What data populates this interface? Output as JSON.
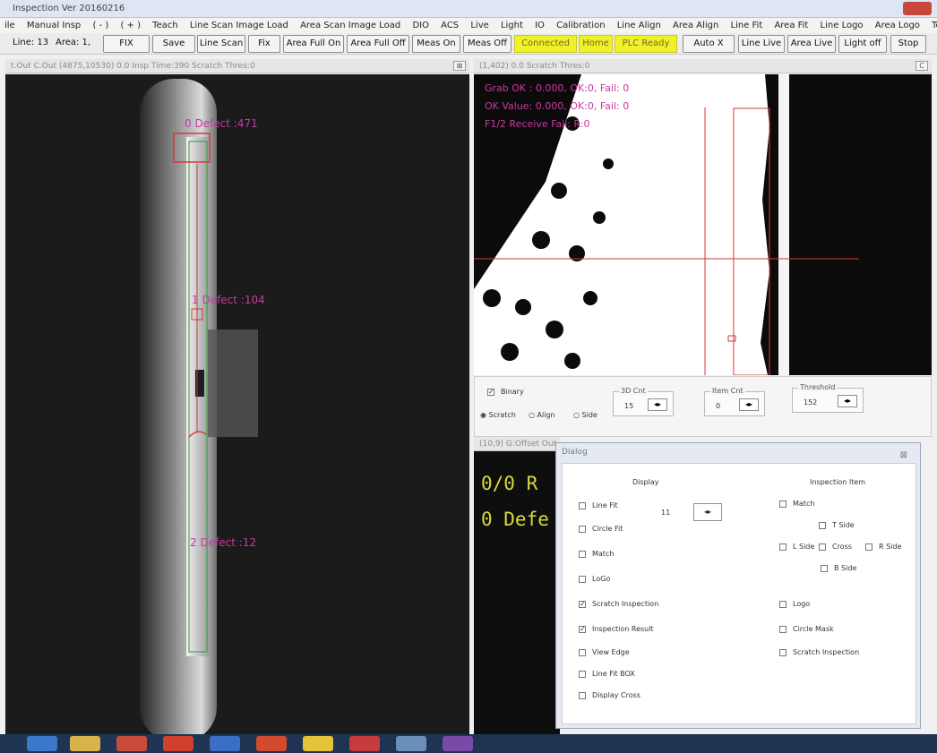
{
  "window": {
    "title": "Inspection Ver 20160216"
  },
  "menu": {
    "items": [
      "ile",
      "Manual Insp",
      "( - )",
      "( + )",
      "Teach",
      "Line Scan Image Load",
      "Area Scan Image Load",
      "DIO",
      "ACS",
      "Live",
      "Light",
      "IO",
      "Calibration",
      "Line Align",
      "Area Align",
      "Line Fit",
      "Area Fit",
      "Line Logo",
      "Area Logo",
      "Total Operation"
    ]
  },
  "toolbar": {
    "line_info": "Line: 13",
    "area_info": "Area: 1,",
    "fix_tag": "FIX",
    "save": "Save",
    "line_scan": "Line Scan",
    "fix": "Fix",
    "area_full_on": "Area Full On",
    "area_full_off": "Area Full Off",
    "meas_on": "Meas On",
    "meas_off": "Meas Off",
    "status_connected": "Connected",
    "status_home": "Home",
    "status_plc": "PLC Ready",
    "auto_x": "Auto X",
    "line_live": "Line Live",
    "area_live": "Area Live",
    "light_off": "Light off",
    "stop": "Stop",
    "extra": "C"
  },
  "left_panel": {
    "header": "t.Out  C.Out  (4875,10530)  0.0    Insp Time:390    Scratch Thres:0",
    "close": "⊠",
    "defect_labels": [
      "0 Defect :471",
      "1 Defect :104",
      "2 Defect :12"
    ]
  },
  "right_panel": {
    "header": "(1,402)    0.0    Scratch Thres:0",
    "lines": [
      "Grab OK : 0.000, OK:0, Fail: 0",
      "OK Value: 0.000, OK:0, Fail: 0",
      "F1/2 Receive Fail: R:0"
    ]
  },
  "controls": {
    "binary": "Binary",
    "binary_checked": true,
    "radios": [
      "Scratch",
      "Align",
      "Side"
    ],
    "radio_selected": "Scratch",
    "fields": [
      {
        "label": "3D Cnt",
        "value": "15"
      },
      {
        "label": "Item Cnt",
        "value": "0"
      },
      {
        "label": "Threshold",
        "value": "152"
      }
    ]
  },
  "bottom_panel": {
    "header": "(10,9)  G:Offset  Out",
    "result_1": "0/0 R",
    "result_2": "0 Defe"
  },
  "dialog": {
    "title": "Dialog",
    "close": "⊠",
    "display_header": "Display",
    "inspection_header": "Inspection Item",
    "spin_value": "11",
    "display_items": [
      {
        "label": "Line Fit",
        "checked": false
      },
      {
        "label": "Circle Fit",
        "checked": false
      },
      {
        "label": "Match",
        "checked": false
      },
      {
        "label": "LoGo",
        "checked": false
      },
      {
        "label": "Scratch Inspection",
        "checked": true
      },
      {
        "label": "Inspection Result",
        "checked": true
      },
      {
        "label": "View Edge",
        "checked": false
      },
      {
        "label": "Line Fit BOX",
        "checked": false
      },
      {
        "label": "Display Cross",
        "checked": false
      }
    ],
    "inspection_items": {
      "match": "Match",
      "t_side": "T Side",
      "l_side": "L Side",
      "cross": "Cross",
      "r_side": "R Side",
      "b_side": "B Side",
      "logo": "Logo",
      "circle_mask": "Circle Mask",
      "scratch": "Scratch Inspection"
    }
  },
  "colors": {
    "highlight": "#f1f12a",
    "overlay_text": "#c43ca0",
    "result_text": "#d9d93b"
  }
}
